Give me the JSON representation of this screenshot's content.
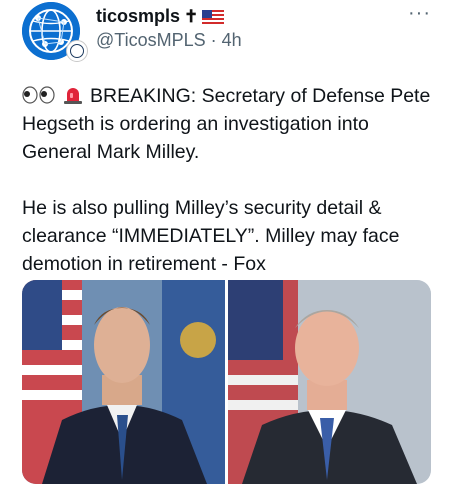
{
  "author": {
    "display_name": "ticosmpls",
    "handle": "@TicosMPLS",
    "separator": "·",
    "time": "4h"
  },
  "icons": {
    "avatar": "globe-network-logo",
    "badge": "seal-icon",
    "cross": "cross-icon",
    "flag": "us-flag-icon",
    "more": "more-icon",
    "eyes": "eyes-emoji-icon",
    "siren": "police-siren-icon"
  },
  "tweet": {
    "paragraph1": "BREAKING: Secretary of Defense Pete Hegseth is ordering an investigation into General Mark Milley.",
    "paragraph2": "He is also pulling Milley’s security detail & clearance “IMMEDIATELY”. Milley may face demotion in retirement - Fox"
  },
  "colors": {
    "text": "#0f1419",
    "secondary": "#536471",
    "avatar_blue": "#0c6fd0"
  }
}
